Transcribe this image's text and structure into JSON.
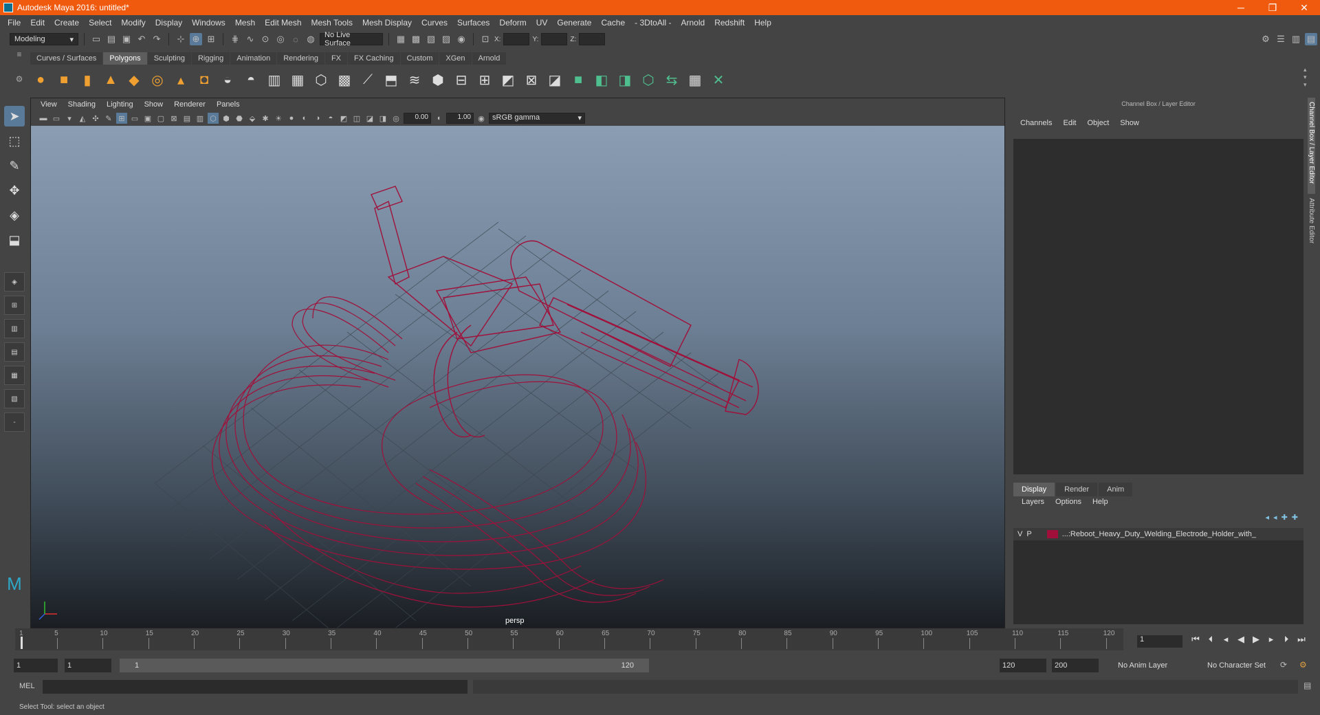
{
  "app": {
    "title": "Autodesk Maya 2016: untitled*"
  },
  "menu": [
    "File",
    "Edit",
    "Create",
    "Select",
    "Modify",
    "Display",
    "Windows",
    "Mesh",
    "Edit Mesh",
    "Mesh Tools",
    "Mesh Display",
    "Curves",
    "Surfaces",
    "Deform",
    "UV",
    "Generate",
    "Cache",
    "- 3DtoAll -",
    "Arnold",
    "Redshift",
    "Help"
  ],
  "status_line": {
    "mode": "Modeling",
    "live_surface": "No Live Surface",
    "x_label": "X:",
    "y_label": "Y:",
    "z_label": "Z:"
  },
  "shelf": {
    "tabs": [
      "Curves / Surfaces",
      "Polygons",
      "Sculpting",
      "Rigging",
      "Animation",
      "Rendering",
      "FX",
      "FX Caching",
      "Custom",
      "XGen",
      "Arnold"
    ],
    "active_tab": "Polygons"
  },
  "viewport": {
    "menus": [
      "View",
      "Shading",
      "Lighting",
      "Show",
      "Renderer",
      "Panels"
    ],
    "exposure": "0.00",
    "gamma": "1.00",
    "color_space": "sRGB gamma",
    "camera": "persp",
    "wire_color": "#a0103a"
  },
  "channel_box": {
    "title": "Channel Box / Layer Editor",
    "menus": [
      "Channels",
      "Edit",
      "Object",
      "Show"
    ],
    "layer_tabs": [
      "Display",
      "Render",
      "Anim"
    ],
    "active_layer_tab": "Display",
    "layer_menus": [
      "Layers",
      "Options",
      "Help"
    ],
    "layer": {
      "v": "V",
      "p": "P",
      "name": "...:Reboot_Heavy_Duty_Welding_Electrode_Holder_with_"
    }
  },
  "side_tabs": [
    "Channel Box / Layer Editor",
    "Attribute Editor"
  ],
  "timeline": {
    "ticks": [
      "5",
      "10",
      "15",
      "20",
      "25",
      "30",
      "35",
      "40",
      "45",
      "50",
      "55",
      "60",
      "65",
      "70",
      "75",
      "80",
      "85",
      "90",
      "95",
      "100",
      "105",
      "110",
      "115",
      "120"
    ],
    "current_frame": "1",
    "marker": "1"
  },
  "range": {
    "start": "1",
    "playback_start": "1",
    "slider_start": "1",
    "slider_end": "120",
    "playback_end": "120",
    "end": "200",
    "anim_layer": "No Anim Layer",
    "character_set": "No Character Set"
  },
  "command_line": {
    "label": "MEL"
  },
  "status": {
    "help": "Select Tool: select an object"
  }
}
